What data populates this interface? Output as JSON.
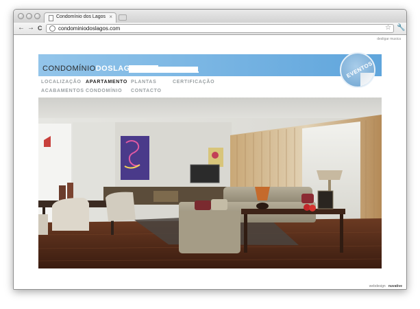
{
  "browser": {
    "tab_title": "Condomínio dos Lagos",
    "tab_close": "×",
    "url": "condominiodoslagos.com",
    "back": "←",
    "forward": "→",
    "reload": "C",
    "star": "☆",
    "wrench": "🔧"
  },
  "page": {
    "mute_link": "desligar musica",
    "logo_light": "CONDOMÍNIO",
    "logo_bold": "DOSLAGOS",
    "badge": "EVENTOS",
    "nav": [
      {
        "label": "LOCALIZAÇÃO",
        "active": false
      },
      {
        "label": "APARTAMENTO",
        "active": true
      },
      {
        "label": "PLANTAS",
        "active": false
      },
      {
        "label": "CERTIFICAÇÃO",
        "active": false
      },
      {
        "label": "ACABAMENTOS",
        "active": false
      },
      {
        "label": "CONDOMÍNIO",
        "active": false
      },
      {
        "label": "CONTACTO",
        "active": false
      }
    ],
    "footer_text": "webdesign",
    "footer_brand": "nuvative"
  },
  "colors": {
    "banner": "#6aaade",
    "nav_inactive": "#9aa0a3",
    "nav_active": "#222222"
  }
}
